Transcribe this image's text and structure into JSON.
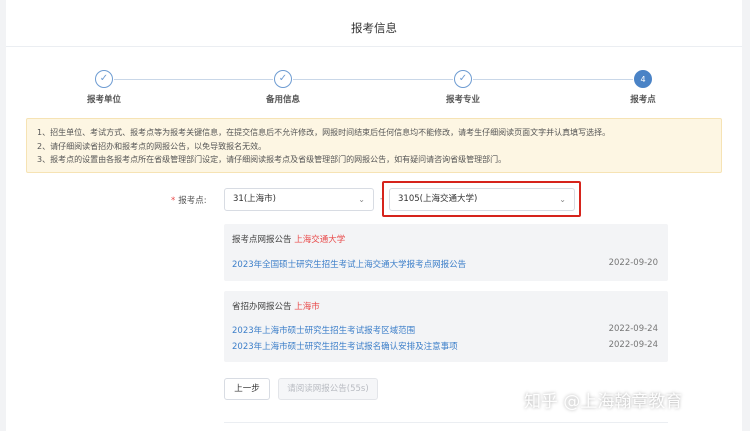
{
  "header": {
    "title": "报考信息"
  },
  "steps": [
    {
      "label": "报考单位",
      "state": "done",
      "mark": "✓"
    },
    {
      "label": "备用信息",
      "state": "done",
      "mark": "✓"
    },
    {
      "label": "报考专业",
      "state": "done",
      "mark": "✓"
    },
    {
      "label": "报考点",
      "state": "active",
      "mark": "4"
    }
  ],
  "notice": [
    "1、招生单位、考试方式、报考点等为报考关键信息，在提交信息后不允许修改，网报时间结束后任何信息均不能修改，请考生仔细阅读页面文字并认真填写选择。",
    "2、请仔细阅读省招办和报考点的网报公告，以免导致报名无效。",
    "3、报考点的设置由各报考点所在省级管理部门设定，请仔细阅读报考点及省级管理部门的网报公告，如有疑问请咨询省级管理部门。"
  ],
  "form": {
    "label": "报考点:",
    "required_mark": "*",
    "province_select": "31(上海市)",
    "separator": "-",
    "site_select": "3105(上海交通大学)"
  },
  "site_panel": {
    "title": "报考点网报公告",
    "title_highlight": "上海交通大学",
    "items": [
      {
        "text": "2023年全国硕士研究生招生考试上海交通大学报考点网报公告",
        "date": "2022-09-20"
      }
    ]
  },
  "province_panel": {
    "title": "省招办网报公告",
    "title_highlight": "上海市",
    "items": [
      {
        "text": "2023年上海市硕士研究生招生考试报考区域范围",
        "date": "2022-09-24"
      },
      {
        "text": "2023年上海市硕士研究生招生考试报名确认安排及注意事项",
        "date": "2022-09-24"
      }
    ]
  },
  "buttons": {
    "prev": "上一步",
    "next_disabled": "请阅读网报公告(55s)"
  },
  "watermark": "知乎 @上海翰章教育",
  "colors": {
    "accent": "#4a83c6",
    "link": "#3d7fc9",
    "highlight_box": "#d6241c",
    "notice_bg": "#fdf6e3"
  }
}
